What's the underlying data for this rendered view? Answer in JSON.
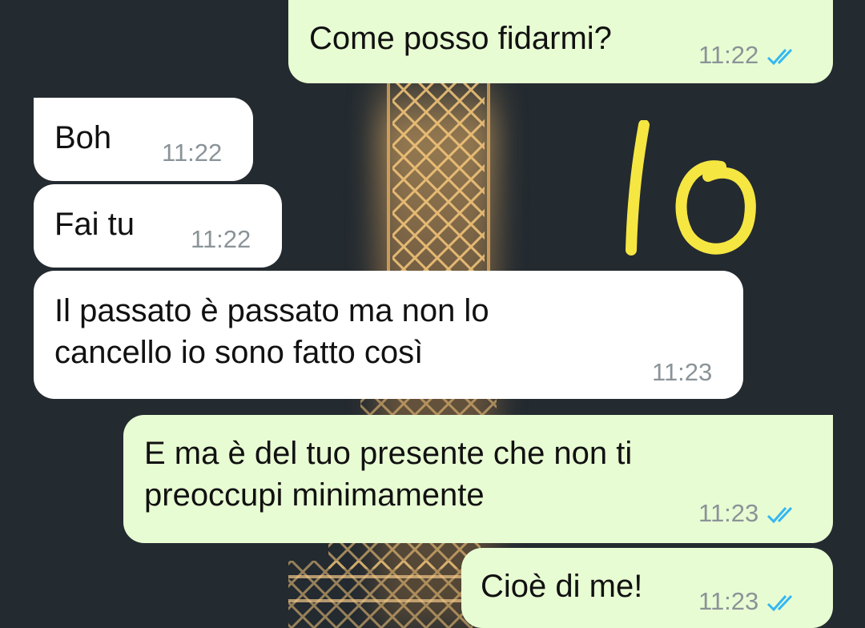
{
  "messages": [
    {
      "text": "Come posso fidarmi?",
      "time": "11:22",
      "direction": "outgoing",
      "ticks": "read"
    },
    {
      "text": "Boh",
      "time": "11:22",
      "direction": "incoming"
    },
    {
      "text": "Fai tu",
      "time": "11:22",
      "direction": "incoming"
    },
    {
      "text": "Il passato è passato ma non lo\ncancello io sono fatto così",
      "time": "11:23",
      "direction": "incoming"
    },
    {
      "text": "E ma è del tuo presente che non ti\npreoccupi minimamente",
      "time": "11:23",
      "direction": "outgoing",
      "ticks": "read"
    },
    {
      "text": "Cioè di me!",
      "time": "11:23",
      "direction": "outgoing",
      "ticks": "read"
    }
  ],
  "annotation": {
    "text": "Io",
    "color": "#f5e642"
  },
  "colors": {
    "outgoing_bubble": "#e8fcd3",
    "incoming_bubble": "#ffffff",
    "read_tick": "#34b7f1"
  }
}
